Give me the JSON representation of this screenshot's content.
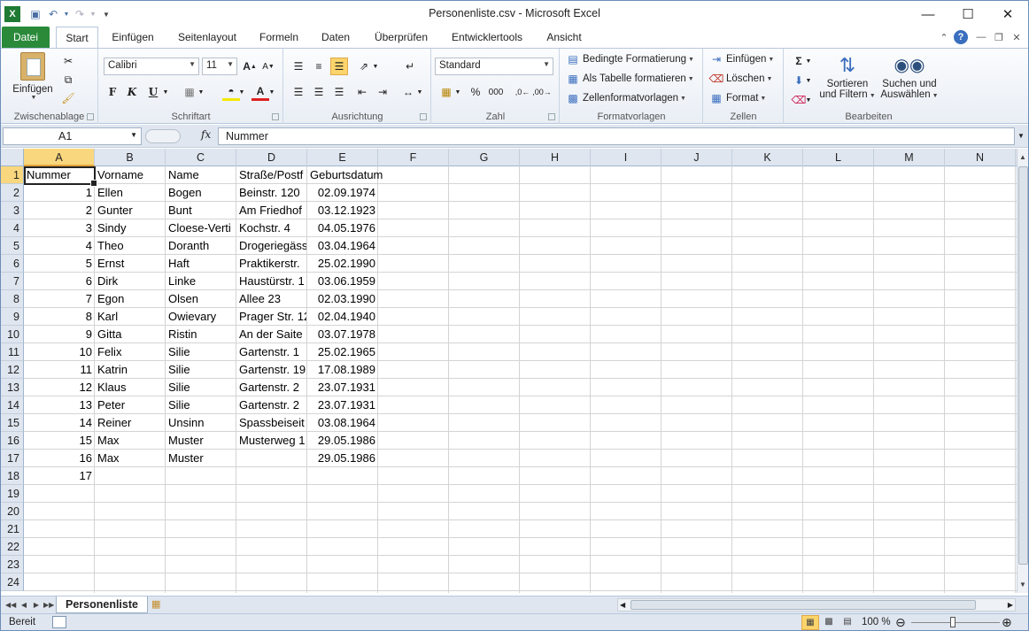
{
  "window": {
    "title": "Personenliste.csv  -  Microsoft Excel",
    "minimize_icon": "minimize-icon",
    "maximize_icon": "maximize-icon",
    "close_icon": "close-icon"
  },
  "ribbon_tabs": [
    "Datei",
    "Start",
    "Einfügen",
    "Seitenlayout",
    "Formeln",
    "Daten",
    "Überprüfen",
    "Entwicklertools",
    "Ansicht"
  ],
  "ribbon": {
    "clipboard": {
      "label": "Zwischenablage",
      "paste": "Einfügen"
    },
    "font": {
      "label": "Schriftart",
      "name": "Calibri",
      "size": "11"
    },
    "alignment": {
      "label": "Ausrichtung"
    },
    "number": {
      "label": "Zahl",
      "format": "Standard"
    },
    "styles": {
      "label": "Formatvorlagen",
      "conditional": "Bedingte Formatierung",
      "as_table": "Als Tabelle formatieren",
      "cell_styles": "Zellenformatvorlagen"
    },
    "cells": {
      "label": "Zellen",
      "insert": "Einfügen",
      "delete": "Löschen",
      "format": "Format"
    },
    "editing": {
      "label": "Bearbeiten",
      "sort_line1": "Sortieren",
      "sort_line2": "und Filtern",
      "find_line1": "Suchen und",
      "find_line2": "Auswählen"
    }
  },
  "formula_bar": {
    "name_box": "A1",
    "fx": "fx",
    "content": "Nummer"
  },
  "grid": {
    "columns": [
      "A",
      "B",
      "C",
      "D",
      "E",
      "F",
      "G",
      "H",
      "I",
      "J",
      "K",
      "L",
      "M",
      "N"
    ],
    "selected_column": "A",
    "selected_row": 1,
    "row_numbers": [
      1,
      2,
      3,
      4,
      5,
      6,
      7,
      8,
      9,
      10,
      11,
      12,
      13,
      14,
      15,
      16,
      17,
      18,
      19,
      20,
      21,
      22,
      23,
      24
    ],
    "rows": [
      [
        "Nummer",
        "Vorname",
        "Name",
        "Straße/Postf",
        "Geburtsdatum"
      ],
      [
        "1",
        "Ellen",
        "Bogen",
        "Beinstr. 120",
        "02.09.1974"
      ],
      [
        "2",
        "Gunter",
        "Bunt",
        "Am Friedhof",
        "03.12.1923"
      ],
      [
        "3",
        "Sindy",
        "Cloese-Verti",
        "Kochstr. 4",
        "04.05.1976"
      ],
      [
        "4",
        "Theo",
        "Doranth",
        "Drogeriegäss",
        "03.04.1964"
      ],
      [
        "5",
        "Ernst",
        "Haft",
        "Praktikerstr.",
        "25.02.1990"
      ],
      [
        "6",
        "Dirk",
        "Linke",
        "Haustürstr. 1",
        "03.06.1959"
      ],
      [
        "7",
        "Egon",
        "Olsen",
        "Allee 23",
        "02.03.1990"
      ],
      [
        "8",
        "Karl",
        "Owievary",
        "Prager Str. 12",
        "02.04.1940"
      ],
      [
        "9",
        "Gitta",
        "Ristin",
        "An der Saite",
        "03.07.1978"
      ],
      [
        "10",
        "Felix",
        "Silie",
        "Gartenstr. 1",
        "25.02.1965"
      ],
      [
        "11",
        "Katrin",
        "Silie",
        "Gartenstr. 19",
        "17.08.1989"
      ],
      [
        "12",
        "Klaus",
        "Silie",
        "Gartenstr. 2",
        "23.07.1931"
      ],
      [
        "13",
        "Peter",
        "Silie",
        "Gartenstr. 2",
        "23.07.1931"
      ],
      [
        "14",
        "Reiner",
        "Unsinn",
        "Spassbeiseit",
        "03.08.1964"
      ],
      [
        "15",
        "Max",
        "Muster",
        "Musterweg 1",
        "29.05.1986"
      ],
      [
        "16",
        "Max",
        "Muster",
        "",
        "29.05.1986"
      ],
      [
        "17",
        "",
        "",
        "",
        ""
      ]
    ]
  },
  "sheet_tabs": {
    "active": "Personenliste"
  },
  "status_bar": {
    "status": "Bereit",
    "zoom": "100 %"
  }
}
